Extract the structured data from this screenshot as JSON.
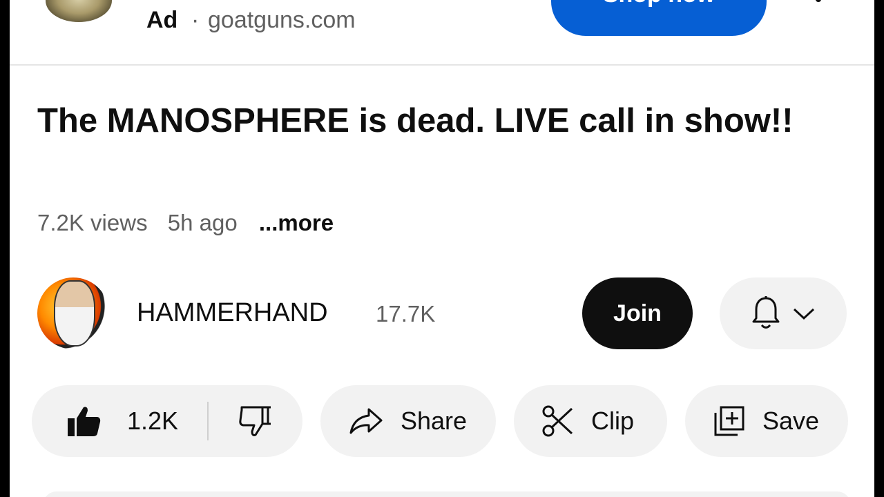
{
  "ad": {
    "label": "Ad",
    "separator": "·",
    "domain": "goatguns.com",
    "cta_label": "Shop now"
  },
  "video": {
    "title": "The MANOSPHERE is dead. LIVE call in show!!",
    "views": "7.2K views",
    "age": "5h ago",
    "more_label": "...more"
  },
  "channel": {
    "name": "HAMMERHAND",
    "subscribers": "17.7K",
    "join_label": "Join"
  },
  "actions": {
    "like_count": "1.2K",
    "share_label": "Share",
    "clip_label": "Clip",
    "save_label": "Save"
  },
  "icons": [
    "thumbs-up-icon",
    "thumbs-down-icon",
    "share-arrow-icon",
    "scissors-icon",
    "add-to-playlist-icon",
    "bell-icon",
    "chevron-down-icon",
    "overflow-menu-icon"
  ],
  "colors": {
    "accent_blue": "#065fd4",
    "join_bg": "#0f0f0f",
    "pill_bg": "#f2f2f2",
    "secondary_text": "#606060"
  }
}
